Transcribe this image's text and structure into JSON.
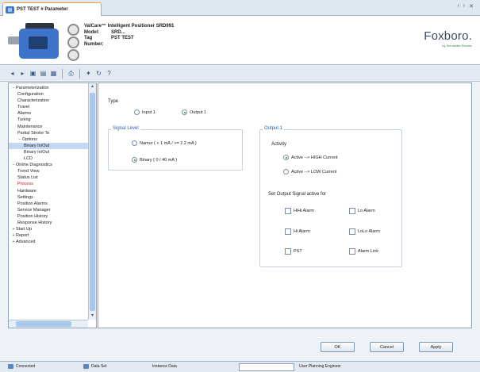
{
  "tab": {
    "title": "PST TEST # Parameter"
  },
  "window_controls": {
    "restore": "‹",
    "minimize": "›",
    "close": "✕"
  },
  "header": {
    "product_line": "ValCare™ Intelligent Positioner SRD991",
    "model_label": "Model:",
    "model_value": "SRD...",
    "tag_label": "Tag Number:",
    "tag_value": "PST TEST",
    "logo": "Foxboro.",
    "logo_sub": "by Schneider Electric"
  },
  "toolbar": {
    "icons": [
      "back-icon",
      "forward-icon",
      "save-icon",
      "load-icon",
      "compare-icon",
      "print-icon",
      "config-icon",
      "refresh-icon",
      "help-icon"
    ],
    "help_glyph": "?"
  },
  "tree": {
    "items": [
      {
        "label": "Parameterization",
        "level": 0,
        "twisty": "−"
      },
      {
        "label": "Configuration",
        "level": 1
      },
      {
        "label": "Characterization",
        "level": 1
      },
      {
        "label": "Travel",
        "level": 1
      },
      {
        "label": "Alarms",
        "level": 1
      },
      {
        "label": "Tuning",
        "level": 1
      },
      {
        "label": "Maintenance",
        "level": 1
      },
      {
        "label": "Partial Stroke Te",
        "level": 1
      },
      {
        "label": "Options",
        "level": 1,
        "twisty": "−"
      },
      {
        "label": "Binary In/Out",
        "level": 2,
        "highlight": true
      },
      {
        "label": "Binary In/Out",
        "level": 2
      },
      {
        "label": "LCD",
        "level": 2
      },
      {
        "label": "Online Diagnostics",
        "level": 0,
        "twisty": "−"
      },
      {
        "label": "Trend View",
        "level": 1
      },
      {
        "label": "Status List",
        "level": 1
      },
      {
        "label": "Process",
        "level": 1,
        "selected": true
      },
      {
        "label": "Hardware",
        "level": 1
      },
      {
        "label": "Settings",
        "level": 1
      },
      {
        "label": "Position Alarms",
        "level": 1
      },
      {
        "label": "Service Manager",
        "level": 1
      },
      {
        "label": "Position History",
        "level": 1
      },
      {
        "label": "Response History",
        "level": 1
      },
      {
        "label": "Start Up",
        "level": 0,
        "twisty": "+"
      },
      {
        "label": "Report",
        "level": 0,
        "twisty": "+"
      },
      {
        "label": "Advanced",
        "level": 0,
        "twisty": "+"
      }
    ]
  },
  "form": {
    "type_label": "Type",
    "type_input": "Input 1",
    "type_output": "Output 1",
    "signal_level_title": "Signal Level",
    "signal_namur": "Namur ( < 1 mA / >= 2.2 mA )",
    "signal_binary": "Binary ( 0 / 40 mA )",
    "output_title": "Output 1",
    "activity_label": "Activity",
    "activity_high": "Active --> HIGH Current",
    "activity_low": "Active --> LOW Current",
    "set_output_label": "Set Output Signal active for",
    "checks": {
      "hihi": "HiHi Alarm",
      "lo": "Lo Alarm",
      "hi": "Hi Alarm",
      "lolo": "LoLo Alarm",
      "pst": "PST",
      "alarm_link": "Alarm Link"
    }
  },
  "buttons": {
    "ok": "OK",
    "cancel": "Cancel",
    "apply": "Apply"
  },
  "statusbar": {
    "connected": "Connected",
    "data_set": "Data Set",
    "instance": "Instance Data",
    "user": "User Planning Engineer"
  }
}
